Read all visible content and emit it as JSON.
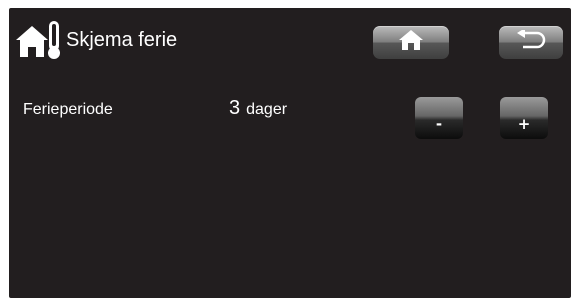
{
  "header": {
    "title": "Skjema ferie",
    "title_icon": "house-thermometer-icon",
    "home_button_icon": "home-icon",
    "back_button_icon": "return-arrow-icon"
  },
  "setting": {
    "label": "Ferieperiode",
    "value": "3",
    "unit": "dager",
    "decrease_label": "-",
    "increase_label": "+"
  },
  "colors": {
    "background": "#221e1f",
    "text": "#ffffff",
    "button_light": "#bcbcbc",
    "button_dark": "#3f3f3f"
  }
}
